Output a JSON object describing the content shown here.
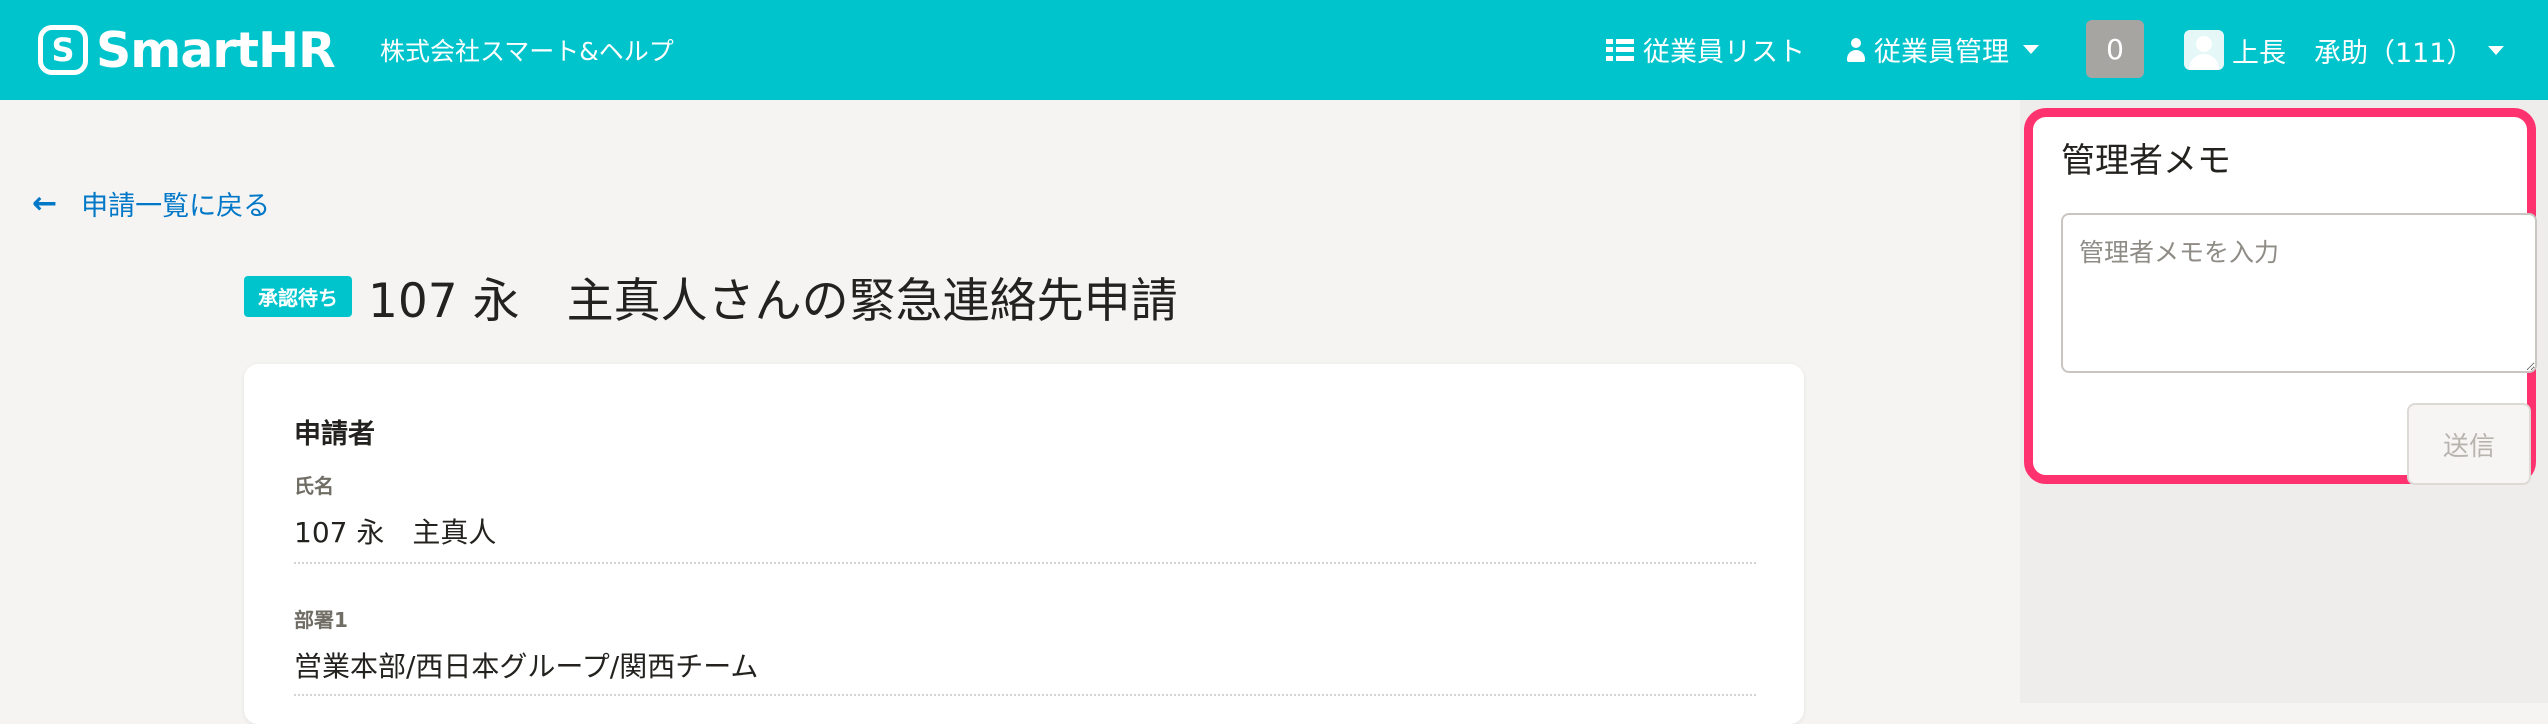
{
  "header": {
    "logo_mark": "S",
    "logo_text": "SmartHR",
    "company": "株式会社スマート&ヘルプ",
    "nav_employee_list": "従業員リスト",
    "nav_employee_manage": "従業員管理",
    "notification_count": "0",
    "user_name": "上長",
    "user_sub": "承助（111）",
    "brand_color": "#00c4cc"
  },
  "main": {
    "back_link": "申請一覧に戻る",
    "status_badge": "承認待ち",
    "title": "107 永　主真人さんの緊急連絡先申請",
    "section_title": "申請者",
    "fields": [
      {
        "label": "氏名",
        "value": "107 永　主真人"
      },
      {
        "label": "部署1",
        "value": "営業本部/西日本グループ/関西チーム"
      }
    ]
  },
  "memo": {
    "title": "管理者メモ",
    "placeholder": "管理者メモを入力",
    "value": "",
    "submit_label": "送信",
    "highlight_color": "#ff3270"
  }
}
